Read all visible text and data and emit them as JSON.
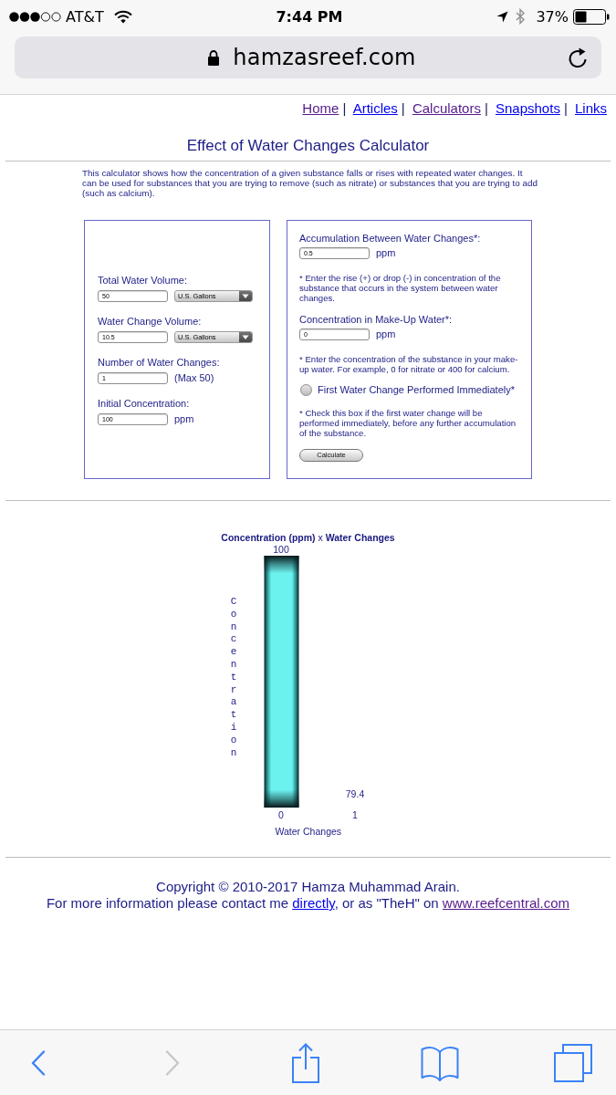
{
  "status_bar": {
    "carrier": "AT&T",
    "time": "7:44 PM",
    "battery": "37%"
  },
  "address_bar": {
    "url": "hamzasreef.com"
  },
  "nav": {
    "links": [
      {
        "label": "Home",
        "visited": true
      },
      {
        "label": "Articles",
        "visited": false
      },
      {
        "label": "Calculators",
        "visited": true
      },
      {
        "label": "Snapshots",
        "visited": false
      },
      {
        "label": "Links",
        "visited": false
      }
    ],
    "separators": [
      "|",
      "|",
      "|",
      "|"
    ]
  },
  "title": "Effect of Water Changes Calculator",
  "description": "This calculator shows how the concentration of a given substance falls or rises with repeated water changes. It can be used for substances that you are trying to remove (such as nitrate) or substances that you are trying to add (such as calcium).",
  "left_panel": {
    "fields": [
      {
        "kind": "select",
        "label": "Total Water Volume:",
        "value": "50",
        "unit": "U.S. Gallons"
      },
      {
        "kind": "select",
        "label": "Water Change Volume:",
        "value": "10.5",
        "unit": "U.S. Gallons"
      },
      {
        "kind": "text",
        "label": "Number of Water Changes:",
        "value": "1",
        "unit": "(Max 50)"
      },
      {
        "kind": "text",
        "label": "Initial Concentration:",
        "value": "100",
        "unit": "ppm"
      }
    ]
  },
  "right_panel": {
    "fields": [
      {
        "label": "Accumulation Between Water Changes*:",
        "value": "0.5",
        "unit": "ppm",
        "note": "* Enter the rise (+) or drop (-) in concentration of the substance that occurs in the system between water changes."
      },
      {
        "label": "Concentration in Make-Up Water*:",
        "value": "0",
        "unit": "ppm",
        "note": "* Enter the concentration of the substance in your make-up water. For example, 0 for nitrate or 400 for calcium."
      }
    ],
    "checkbox": {
      "label": "First Water Change Performed Immediately*",
      "checked": false,
      "note": "* Check this box if the first water change will be performed immediately, before any further accumulation of the substance."
    },
    "button": "Calculate"
  },
  "chart": {
    "chart_data": {
      "type": "bar",
      "title": "**Concentration (ppm)** x **Water Changes**",
      "xlabel": "Water Changes",
      "ylabel": "Concentration",
      "categories": [
        "0",
        "1"
      ],
      "values": [
        100,
        79.4
      ],
      "ylim": [
        79.4,
        100
      ],
      "data_labels": true
    }
  },
  "footer": {
    "copyright": "Copyright © 2010-2017 Hamza Muhammad Arain.",
    "contact": [
      {
        "kind": "text",
        "text": "For more information please contact me "
      },
      {
        "kind": "link",
        "text": "directly",
        "visited": false
      },
      {
        "kind": "text",
        "text": ", or as \"TheH\" on "
      },
      {
        "kind": "link",
        "text": "www.reefcentral.com",
        "visited": true
      }
    ]
  },
  "toolbar": [
    {
      "kind": "back",
      "disabled": false
    },
    {
      "kind": "forward",
      "disabled": true
    },
    {
      "kind": "share",
      "disabled": false
    },
    {
      "kind": "bookmarks",
      "disabled": false
    },
    {
      "kind": "tabs",
      "disabled": false
    }
  ]
}
